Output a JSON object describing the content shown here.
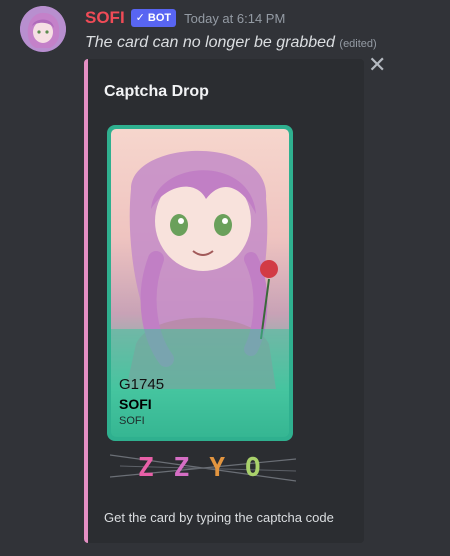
{
  "message": {
    "username": "SOFI",
    "bot_badge": "BOT",
    "timestamp": "Today at 6:14 PM",
    "text": "The card can no longer be grabbed",
    "edited": "(edited)"
  },
  "embed": {
    "accent_color": "#e58fc4",
    "title": "Captcha Drop",
    "card": {
      "code": "G1745",
      "name": "SOFI",
      "series": "SOFI",
      "frame_color": "#2fb08f"
    },
    "captcha": {
      "chars": [
        "Z",
        "Z",
        "Y",
        "O"
      ],
      "colors": [
        "#e860a8",
        "#d56ec4",
        "#e3953f",
        "#a9d16b"
      ]
    },
    "footer": "Get the card by typing the captcha code"
  },
  "icons": {
    "close": "close-icon",
    "verified": "check-icon"
  },
  "colors": {
    "background": "#313338",
    "username": "#f04b57",
    "badge": "#5865f2"
  }
}
